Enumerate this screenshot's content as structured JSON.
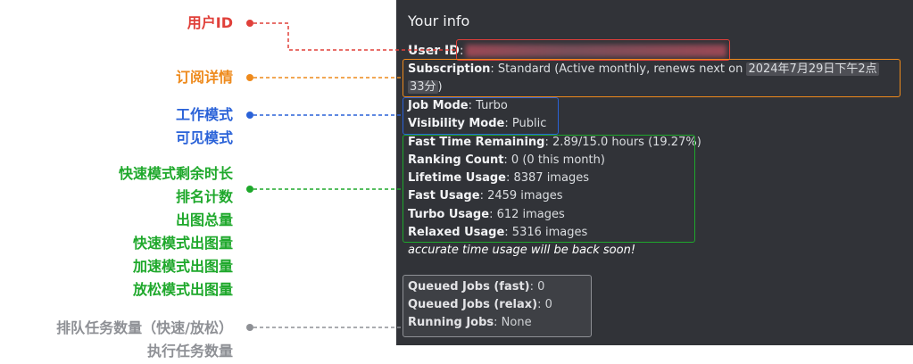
{
  "panel": {
    "title": "Your info",
    "user_id_label": "User ID",
    "user_id_sep": ":",
    "subscription_label": "Subscription",
    "subscription_value": ": Standard (Active monthly, renews next on ",
    "subscription_date_1": "2024年7月29日下午2点",
    "subscription_date_2": "33分",
    "subscription_close": ")",
    "job_mode_label": "Job Mode",
    "job_mode_value": ": Turbo",
    "visibility_label": "Visibility Mode",
    "visibility_value": ": Public",
    "fast_time_label": "Fast Time Remaining",
    "fast_time_value": ": 2.89/15.0 hours (19.27%)",
    "ranking_label": "Ranking Count",
    "ranking_value": ": 0 (0 this month)",
    "lifetime_label": "Lifetime Usage",
    "lifetime_value": ": 8387 images",
    "fast_usage_label": "Fast Usage",
    "fast_usage_value": ": 2459 images",
    "turbo_usage_label": "Turbo Usage",
    "turbo_usage_value": ": 612 images",
    "relaxed_usage_label": "Relaxed Usage",
    "relaxed_usage_value": ": 5316 images",
    "note": "accurate time usage will be back soon!",
    "queued_fast_label": "Queued Jobs (fast)",
    "queued_fast_value": ": 0",
    "queued_relax_label": "Queued Jobs (relax)",
    "queued_relax_value": ": 0",
    "running_label": "Running Jobs",
    "running_value": ": None"
  },
  "annotations": {
    "user_id": [
      "用户ID"
    ],
    "subscription": [
      "订阅详情"
    ],
    "modes": [
      "工作模式",
      "可见模式"
    ],
    "usage": [
      "快速模式剩余时长",
      "排名计数",
      "出图总量",
      "快速模式出图量",
      "加速模式出图量",
      "放松模式出图量"
    ],
    "jobs": [
      "排队任务数量（快速/放松）",
      "执行任务数量"
    ]
  },
  "colors": {
    "red": "#e0403a",
    "orange": "#ee8a1c",
    "blue": "#2a62d8",
    "green": "#1ea82b",
    "gray": "#8e9095",
    "panel_bg": "#313338"
  }
}
